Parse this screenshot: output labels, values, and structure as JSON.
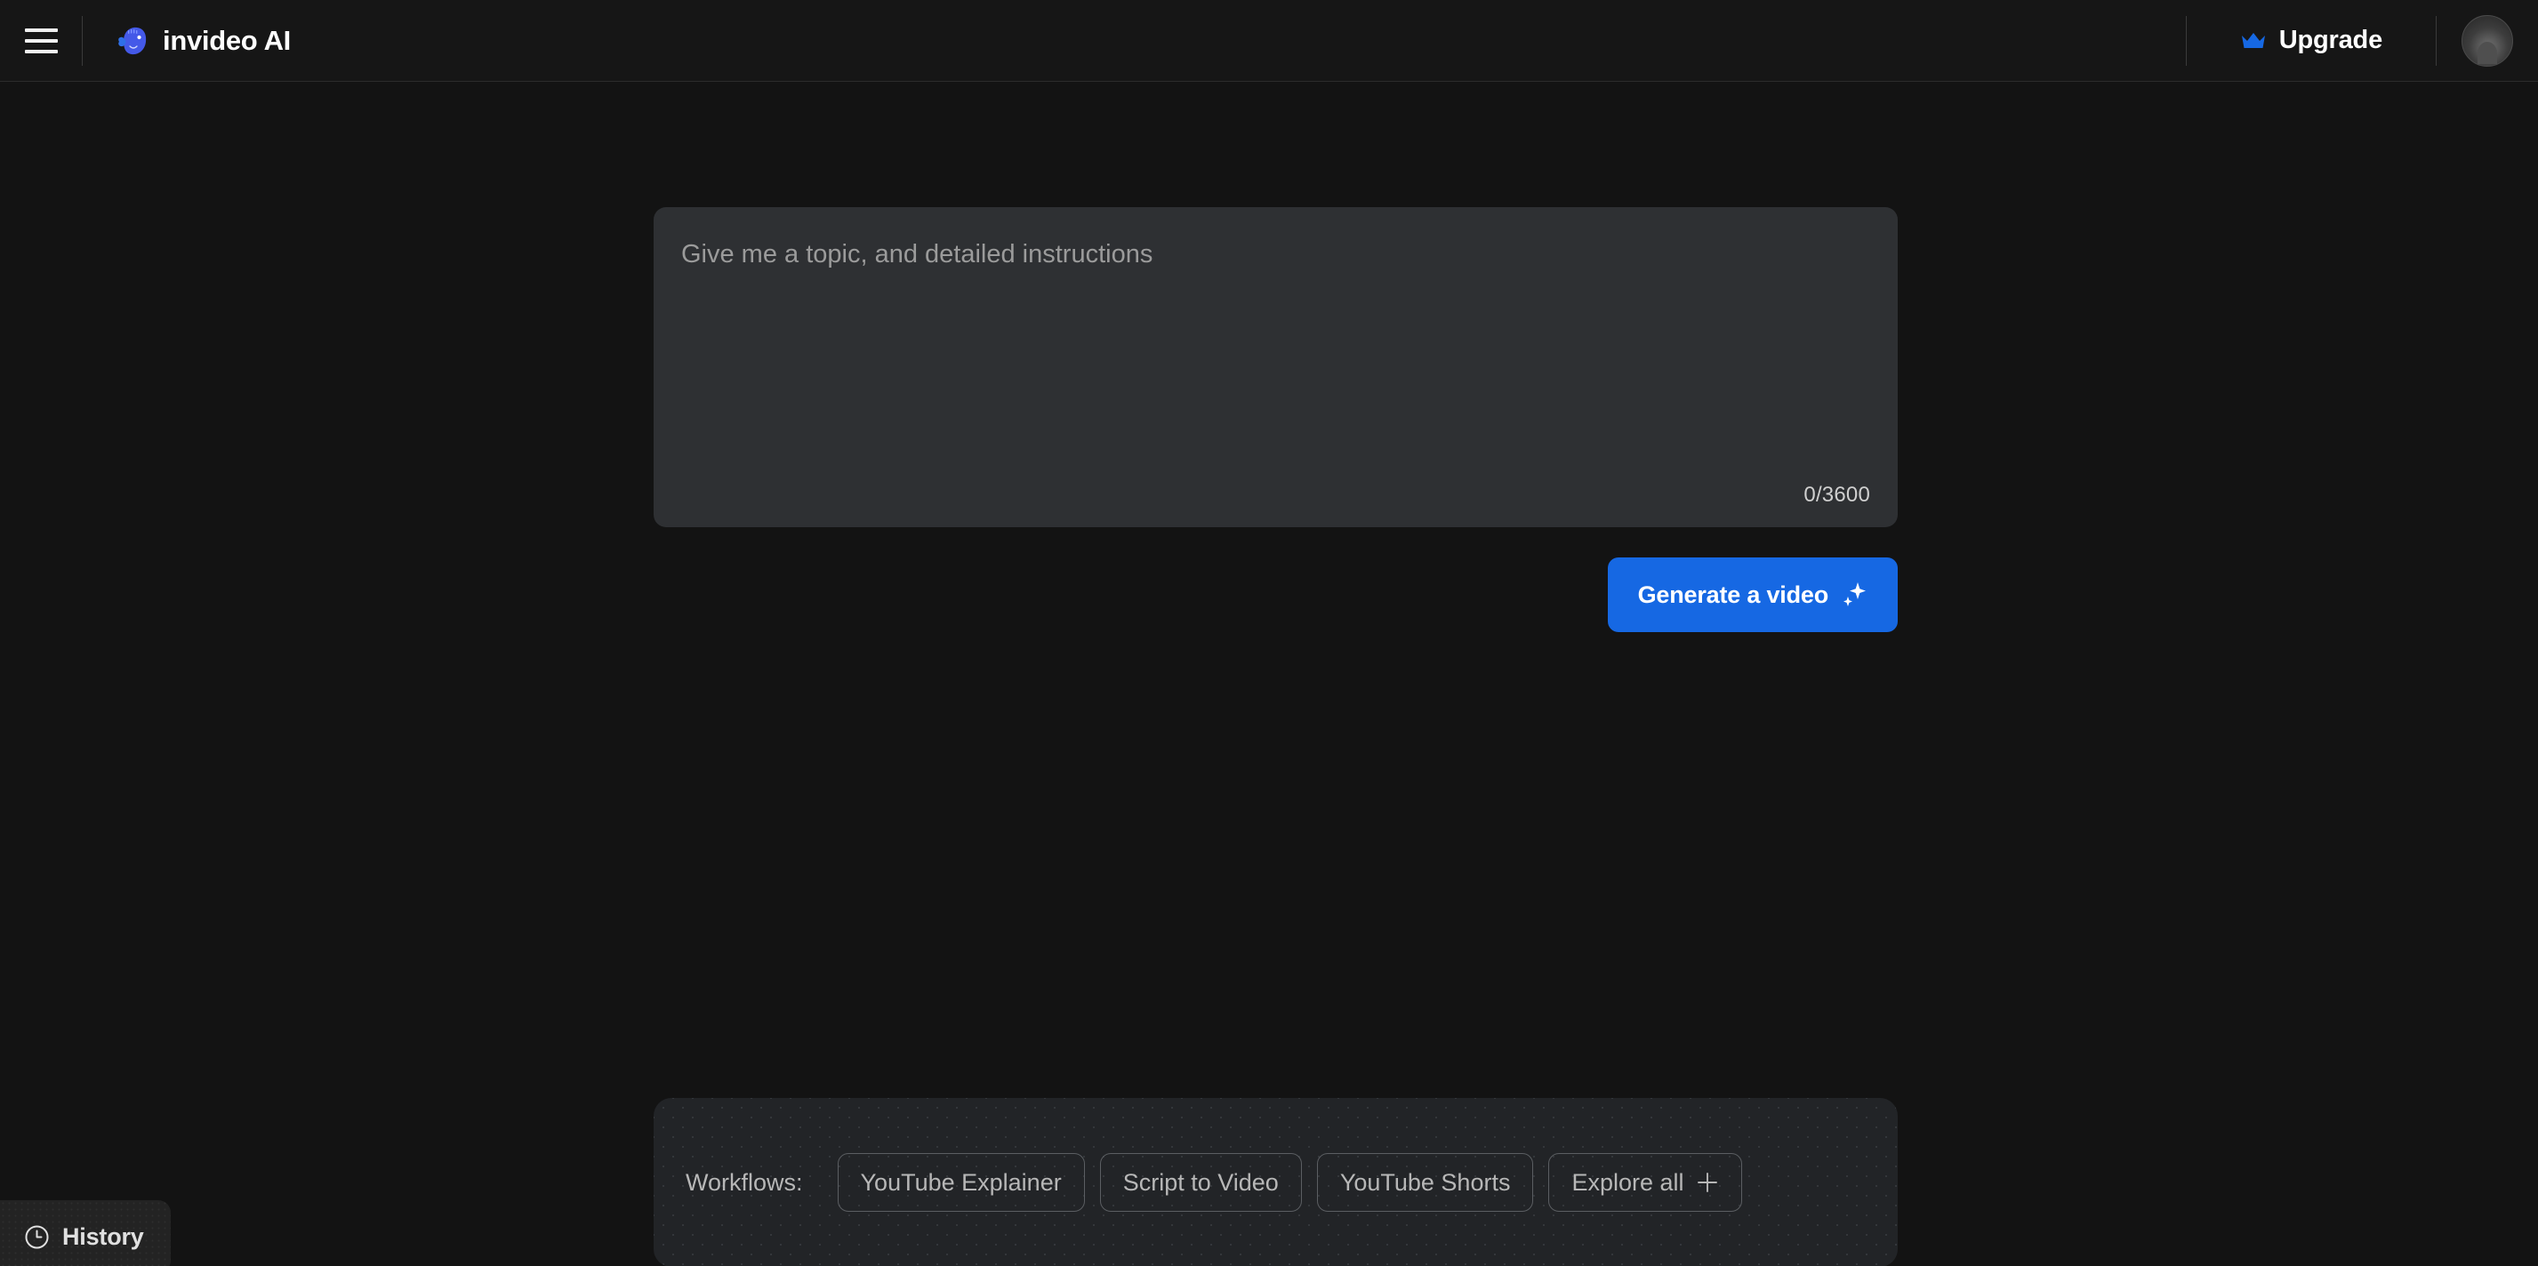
{
  "header": {
    "menu_icon": "hamburger-menu-icon",
    "brand": {
      "logo_icon": "invideo-blob-logo-icon",
      "name": "invideo AI"
    },
    "upgrade": {
      "icon": "crown-icon",
      "label": "Upgrade",
      "color": "#1668e3"
    },
    "avatar": {
      "icon": "user-avatar",
      "alt": "User profile photo"
    }
  },
  "main": {
    "composer": {
      "prompt": {
        "value": "",
        "placeholder": "Give me a topic, and detailed instructions"
      },
      "char_counter": "0/3600",
      "char_count": 0,
      "char_limit": 3600,
      "generate_button": {
        "label": "Generate a video",
        "icon": "sparkle-icon",
        "color": "#1668e3"
      }
    },
    "workflows": {
      "label": "Workflows:",
      "chips": [
        {
          "label": "YouTube Explainer",
          "icon": null
        },
        {
          "label": "Script to Video",
          "icon": null
        },
        {
          "label": "YouTube Shorts",
          "icon": null
        },
        {
          "label": "Explore all",
          "icon": "plus-icon"
        }
      ]
    }
  },
  "history": {
    "icon": "clock-icon",
    "label": "History"
  },
  "theme": {
    "background": "#131313",
    "header_background": "#161616",
    "panel_background": "#222427",
    "textarea_background": "#2e3033",
    "accent": "#1668e3",
    "text_primary": "#ffffff",
    "text_muted": "#b7b7b7"
  }
}
